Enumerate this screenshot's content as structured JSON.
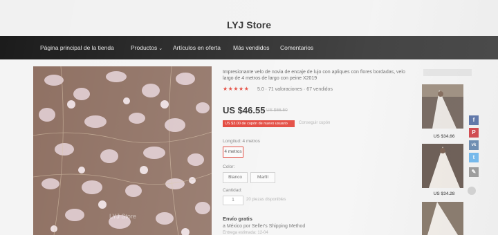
{
  "store": {
    "title": "LYJ Store"
  },
  "nav": {
    "items": [
      {
        "label": "Página principal de la tienda"
      },
      {
        "label": "Productos",
        "has_arrow": true
      },
      {
        "label": "Artículos en oferta"
      },
      {
        "label": "Más vendidos"
      },
      {
        "label": "Comentarios"
      }
    ],
    "arrow_icon": "chevron-down-icon"
  },
  "product": {
    "title": "Impresionante velo de novia de encaje de lujo con apliques con flores bordadas, velo largo de 4 metros de largo con peine X2019",
    "rating_stars": "★★★★★",
    "rating": 5,
    "rating_text": "5.0 · 71 valoraciones · 67 vendidos",
    "price": "US $46.55",
    "old_price": "US $66.50",
    "coupon": "US $3.00 de cupón de nuevo usuario",
    "coupon_link": "Conseguir cupón",
    "image_watermark": "LYJ Store"
  },
  "options": {
    "length_label": "Longitud: 4 metros",
    "length_value": "4 metros",
    "color_label": "Color:",
    "colors": [
      "Blanco",
      "Marfil"
    ],
    "quantity_label": "Cantidad:",
    "quantity_value": "1",
    "quantity_note": "20 piezas disponibles"
  },
  "shipping": {
    "title": "Envío gratis",
    "desc": "a México por Seller's Shipping Method",
    "sub": "Entrega estimada: 12-04"
  },
  "sidebar": {
    "items": [
      {
        "price": "US $34.66"
      },
      {
        "price": "US $34.28"
      }
    ]
  },
  "share": {
    "buttons": [
      {
        "icon": "facebook-icon",
        "glyph": "f",
        "color": "#3b5998"
      },
      {
        "icon": "pinterest-icon",
        "glyph": "P",
        "color": "#cb2027"
      },
      {
        "icon": "vk-icon",
        "glyph": "vk",
        "color": "#4c75a3"
      },
      {
        "icon": "twitter-icon",
        "glyph": "t",
        "color": "#55acee"
      },
      {
        "icon": "edit-icon",
        "glyph": "✎",
        "color": "#888888"
      }
    ]
  },
  "colors": {
    "accent": "#e0352a",
    "nav_bg": "#1b1b1b"
  }
}
